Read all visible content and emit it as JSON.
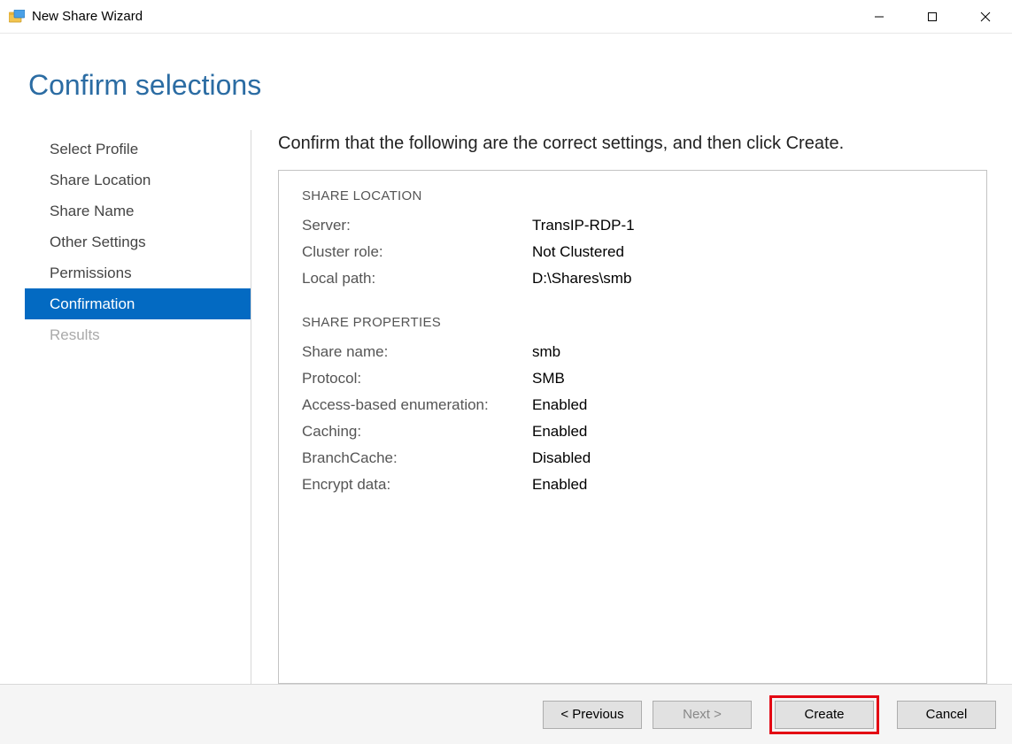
{
  "window": {
    "title": "New Share Wizard"
  },
  "heading": "Confirm selections",
  "sidebar": {
    "items": [
      {
        "label": "Select Profile",
        "state": "normal"
      },
      {
        "label": "Share Location",
        "state": "normal"
      },
      {
        "label": "Share Name",
        "state": "normal"
      },
      {
        "label": "Other Settings",
        "state": "normal"
      },
      {
        "label": "Permissions",
        "state": "normal"
      },
      {
        "label": "Confirmation",
        "state": "selected"
      },
      {
        "label": "Results",
        "state": "disabled"
      }
    ]
  },
  "main": {
    "instruction": "Confirm that the following are the correct settings, and then click Create.",
    "sections": {
      "shareLocation": {
        "title": "SHARE LOCATION",
        "rows": {
          "serverLabel": "Server:",
          "serverValue": "TransIP-RDP-1",
          "clusterRoleLabel": "Cluster role:",
          "clusterRoleValue": "Not Clustered",
          "localPathLabel": "Local path:",
          "localPathValue": "D:\\Shares\\smb"
        }
      },
      "shareProperties": {
        "title": "SHARE PROPERTIES",
        "rows": {
          "shareNameLabel": "Share name:",
          "shareNameValue": "smb",
          "protocolLabel": "Protocol:",
          "protocolValue": "SMB",
          "abeLabel": "Access-based enumeration:",
          "abeValue": "Enabled",
          "cachingLabel": "Caching:",
          "cachingValue": "Enabled",
          "branchCacheLabel": "BranchCache:",
          "branchCacheValue": "Disabled",
          "encryptLabel": "Encrypt data:",
          "encryptValue": "Enabled"
        }
      }
    }
  },
  "footer": {
    "previous": "< Previous",
    "next": "Next >",
    "create": "Create",
    "cancel": "Cancel"
  }
}
